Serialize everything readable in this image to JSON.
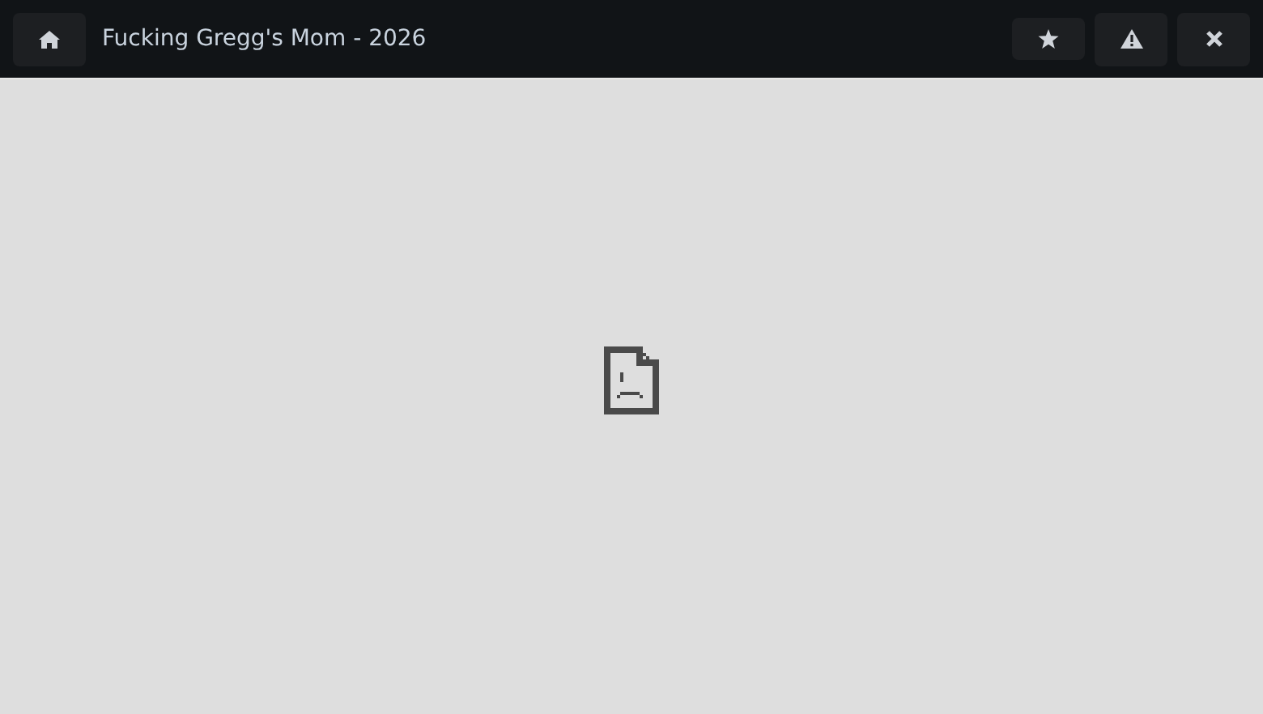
{
  "window": {
    "title": "Fucking Gregg's Mom - 2026"
  }
}
